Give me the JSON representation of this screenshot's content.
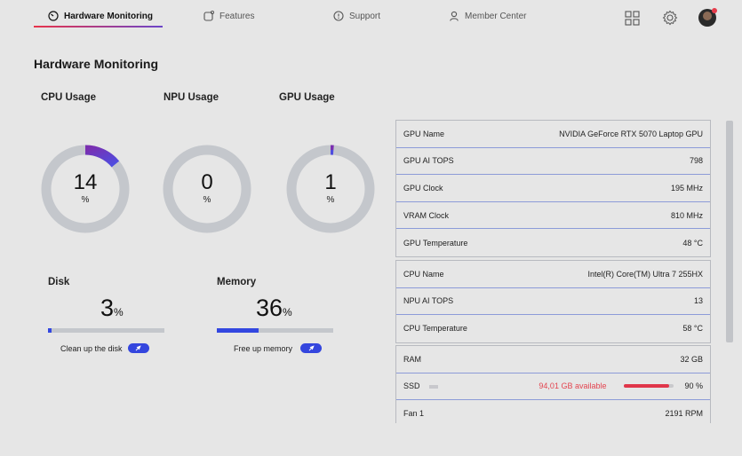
{
  "nav": {
    "items": [
      {
        "label": "Hardware Monitoring",
        "icon": "gauge-icon"
      },
      {
        "label": "Features",
        "icon": "features-icon"
      },
      {
        "label": "Support",
        "icon": "support-icon"
      },
      {
        "label": "Member Center",
        "icon": "person-icon"
      }
    ],
    "accent_start": "#e8334a",
    "accent_end": "#6b45c9"
  },
  "page_title": "Hardware Monitoring",
  "gauges": {
    "cpu": {
      "label": "CPU Usage",
      "value": "14",
      "unit": "%",
      "fraction": 0.14
    },
    "npu": {
      "label": "NPU Usage",
      "value": "0",
      "unit": "%",
      "fraction": 0
    },
    "gpu": {
      "label": "GPU Usage",
      "value": "1",
      "unit": "%",
      "fraction": 0.01
    }
  },
  "disk": {
    "label": "Disk",
    "value": "3",
    "unit": "%",
    "fraction": 0.03,
    "action": "Clean up the disk"
  },
  "memory": {
    "label": "Memory",
    "value": "36",
    "unit": "%",
    "fraction": 0.36,
    "action": "Free up memory"
  },
  "gpu_panel": [
    {
      "key": "GPU Name",
      "value": "NVIDIA GeForce RTX 5070 Laptop GPU"
    },
    {
      "key": "GPU AI TOPS",
      "value": "798"
    },
    {
      "key": "GPU Clock",
      "value": "195 MHz"
    },
    {
      "key": "VRAM Clock",
      "value": "810 MHz"
    },
    {
      "key": "GPU Temperature",
      "value": "48 °C"
    }
  ],
  "cpu_panel": [
    {
      "key": "CPU Name",
      "value": "Intel(R) Core(TM) Ultra 7 255HX"
    },
    {
      "key": "NPU AI TOPS",
      "value": "13"
    },
    {
      "key": "CPU Temperature",
      "value": "58 °C"
    }
  ],
  "system_panel": {
    "ram": {
      "key": "RAM",
      "value": "32 GB"
    },
    "ssd": {
      "key": "SSD",
      "available": "94,01 GB available",
      "value": "90 %",
      "fraction": 0.9
    },
    "fan": {
      "key": "Fan 1",
      "value": "2191 RPM"
    }
  },
  "colors": {
    "bar_fill": "#3347e0",
    "ssd_fill": "#e0364a",
    "ring_track": "#c4c7cc"
  }
}
